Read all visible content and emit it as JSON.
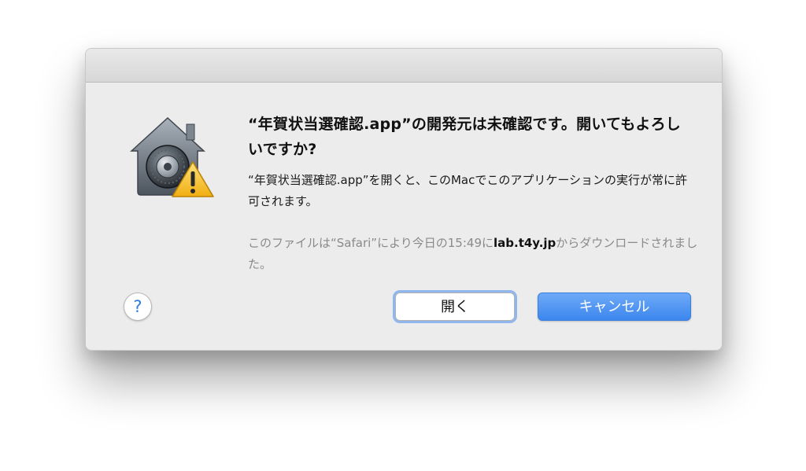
{
  "dialog": {
    "heading": "“年賀状当選確認.app”の開発元は未確認です。開いてもよろしいですか?",
    "message": "“年賀状当選確認.app”を開くと、このMacでこのアプリケーションの実行が常に許可されます。",
    "download_prefix": "このファイルは“Safari”により今日の15:49に",
    "download_host": "lab.t4y.jp",
    "download_suffix": "からダウンロードされました。",
    "icon": "gatekeeper-vault-warning-icon"
  },
  "buttons": {
    "help_label": "?",
    "open_label": "開く",
    "cancel_label": "キャンセル"
  },
  "colors": {
    "accent": "#3c86ee",
    "warning": "#f5c028",
    "dialog_bg": "#ececec"
  }
}
